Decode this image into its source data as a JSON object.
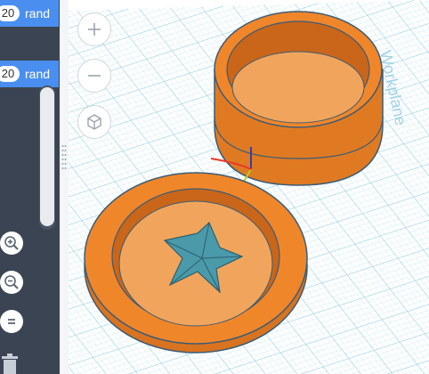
{
  "code_blocks": [
    {
      "number": "20",
      "word": "rand"
    },
    {
      "number": "20",
      "word": "rand"
    }
  ],
  "zoom_controls": {
    "zoom_in_icon": "magnifier-plus-icon",
    "zoom_out_icon": "magnifier-minus-icon",
    "reset_icon": "equals-icon"
  },
  "view_controls": {
    "zoom_in_icon": "plus-icon",
    "zoom_out_icon": "minus-icon",
    "home_view_icon": "cube-icon"
  },
  "workplane": {
    "label": "Workplane",
    "grid_color": "#a9d9ec",
    "background": "#ffffff"
  },
  "colors": {
    "sidebar": "#3b4452",
    "block_accent": "#4a8ff0",
    "shape_orange": "#f0862a",
    "shape_outline": "#3b5c76",
    "star_teal": "#4a9aaa"
  }
}
